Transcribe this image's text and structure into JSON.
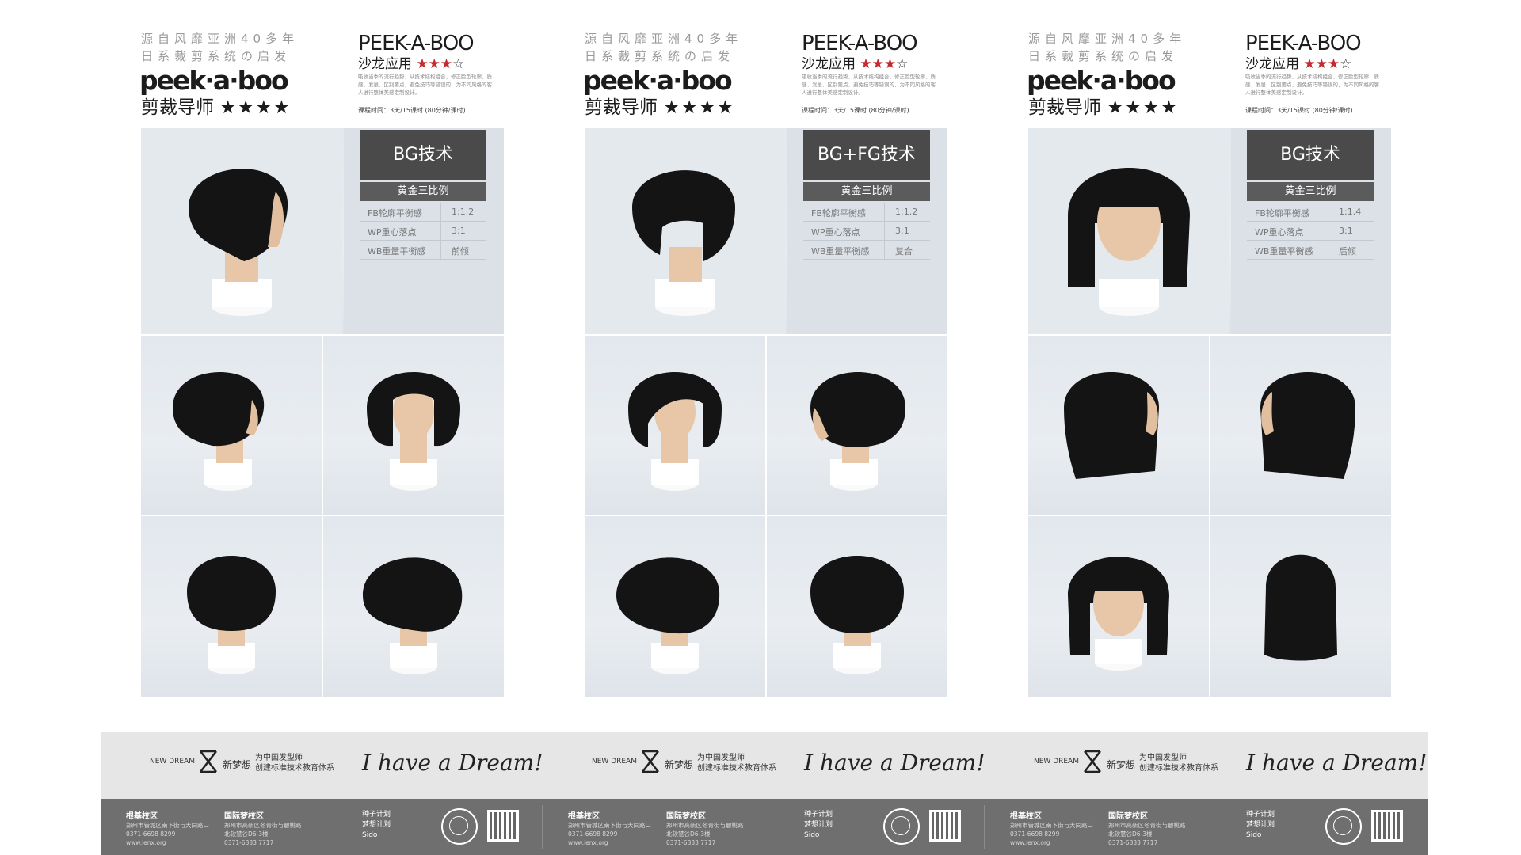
{
  "pages": [
    {
      "tagline_1": "源自风靡亚洲40多年",
      "tagline_2": "日系裁剪系统の启发",
      "logo": "peek·a·boo",
      "mentor": "剪裁导师",
      "mentor_stars": "★★★★",
      "title": "PEEK-A-BOO",
      "subtitle": "沙龙应用",
      "subtitle_stars_filled": "★★★",
      "subtitle_stars_empty": "☆",
      "desc": "吸收当季的流行趋势，从技术结构组合，修正脸型轮廓、质感、发量、区别要点，避免技巧等错误的，为不同风格的客人进行整体美感定制设计。",
      "course": "课程时间：3天/15课时 (80分钟/课时)",
      "card": {
        "heading": "BG技术",
        "sub": "黄金三比例",
        "rows": [
          {
            "k": "FB轮廓平衡感",
            "v": "1:1.2"
          },
          {
            "k": "WP重心落点",
            "v": "3:1"
          },
          {
            "k": "WB重量平衡感",
            "v": "前倾"
          }
        ]
      }
    },
    {
      "tagline_1": "源自风靡亚洲40多年",
      "tagline_2": "日系裁剪系统の启发",
      "logo": "peek·a·boo",
      "mentor": "剪裁导师",
      "mentor_stars": "★★★★",
      "title": "PEEK-A-BOO",
      "subtitle": "沙龙应用",
      "subtitle_stars_filled": "★★★",
      "subtitle_stars_empty": "☆",
      "desc": "吸收当季的流行趋势，从技术结构组合，修正脸型轮廓、质感、发量、区别要点，避免技巧等错误的，为不同风格的客人进行整体美感定制设计。",
      "course": "课程时间：3天/15课时 (80分钟/课时)",
      "card": {
        "heading": "BG+FG技术",
        "sub": "黄金三比例",
        "rows": [
          {
            "k": "FB轮廓平衡感",
            "v": "1:1.2"
          },
          {
            "k": "WP重心落点",
            "v": "3:1"
          },
          {
            "k": "WB重量平衡感",
            "v": "复合"
          }
        ]
      }
    },
    {
      "tagline_1": "源自风靡亚洲40多年",
      "tagline_2": "日系裁剪系统の启发",
      "logo": "peek·a·boo",
      "mentor": "剪裁导师",
      "mentor_stars": "★★★★",
      "title": "PEEK-A-BOO",
      "subtitle": "沙龙应用",
      "subtitle_stars_filled": "★★★",
      "subtitle_stars_empty": "☆",
      "desc": "吸收当季的流行趋势，从技术结构组合，修正脸型轮廓、质感、发量、区别要点，避免技巧等错误的，为不同风格的客人进行整体美感定制设计。",
      "course": "课程时间：3天/15课时 (80分钟/课时)",
      "card": {
        "heading": "BG技术",
        "sub": "黄金三比例",
        "rows": [
          {
            "k": "FB轮廓平衡感",
            "v": "1:1.4"
          },
          {
            "k": "WP重心落点",
            "v": "3:1"
          },
          {
            "k": "WB重量平衡感",
            "v": "后倾"
          }
        ]
      }
    }
  ],
  "footer": {
    "brand_en": "NEW DREAM",
    "brand_cn": "新梦想",
    "mission_1": "为中国发型师",
    "mission_2": "创建标准技术教育体系",
    "slogan": "I have a Dream!",
    "campus_1": {
      "name": "根基校区",
      "addr": "郑州市管城区南下街与大同路口",
      "tel": "0371-6698 8299",
      "web": "www.ienx.org"
    },
    "campus_2": {
      "name": "国际梦校区",
      "addr": "郑州市高新区冬青街与碧桃路",
      "addr2": "北软慧谷D6-3楼",
      "tel": "0371-6333 7717"
    },
    "partner_1": "种子计划",
    "partner_2": "梦想计划",
    "partner_3": "Sido"
  },
  "colors": {
    "accent_red": "#c5282d",
    "card_dark": "#4a4a4a",
    "footer_dark": "#6f6f6f"
  }
}
